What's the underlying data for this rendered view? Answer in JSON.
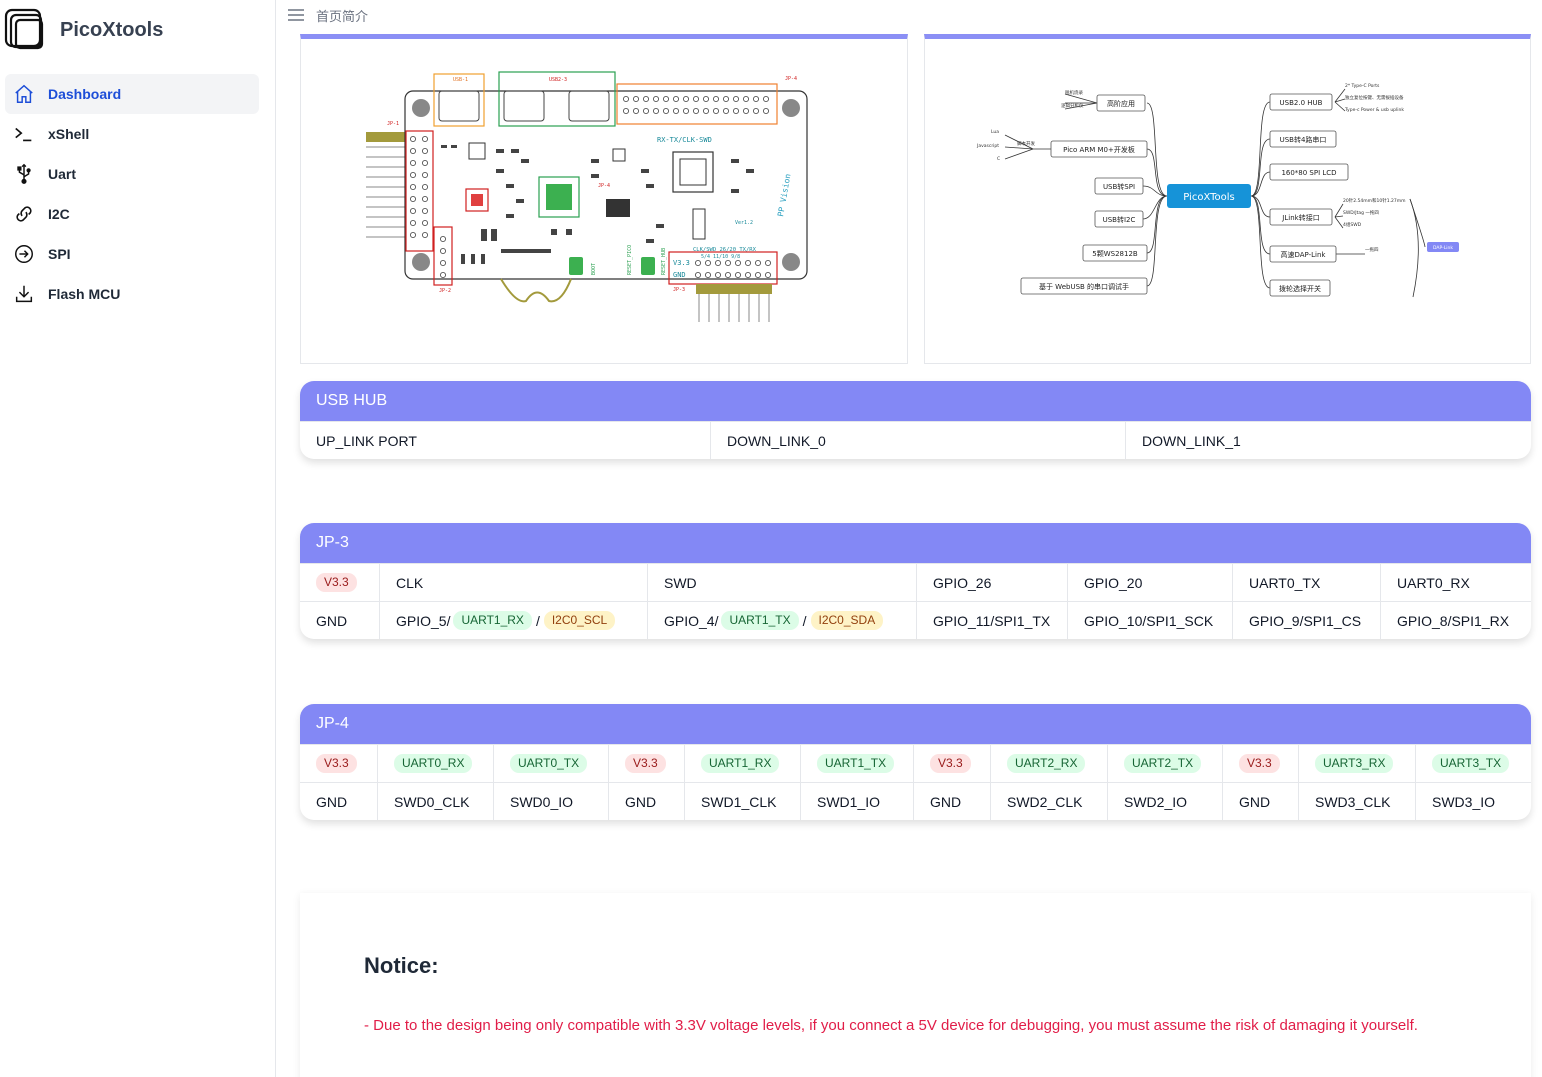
{
  "app": {
    "name": "PicoXtools"
  },
  "sidebar": {
    "items": [
      {
        "label": "Dashboard",
        "icon": "home-icon",
        "active": true
      },
      {
        "label": "xShell",
        "icon": "terminal-icon"
      },
      {
        "label": "Uart",
        "icon": "usb-icon"
      },
      {
        "label": "I2C",
        "icon": "link-icon"
      },
      {
        "label": "SPI",
        "icon": "arrow-circle-icon"
      },
      {
        "label": "Flash MCU",
        "icon": "download-icon"
      }
    ]
  },
  "topbar": {
    "breadcrumb": "首页简介"
  },
  "images": {
    "board": {
      "labels": [
        "USB-1",
        "USB2-3",
        "JP-4",
        "JP-1",
        "JP-2",
        "JP-3",
        "RX-TX/CLK-SWD",
        "CLK/SWD 26/20 TX/RX",
        "5/4 11/10 9/8",
        "V3.3",
        "GND",
        "BOOT",
        "RESET_PICO",
        "RESET_HUB",
        "Ver1.2",
        "PP Vision"
      ]
    },
    "mindmap": {
      "center": "PicoXTools",
      "left": [
        "高阶应用",
        "Pico ARM M0+开发板",
        "USB转SPI",
        "USB转I2C",
        "5颗WS2812B",
        "基于 WebUSB 的串口调试手"
      ],
      "left_sub": [
        "脱机烧录",
        "逻辑分析仪",
        "Lua",
        "Javascript",
        "C",
        "脚本开发"
      ],
      "right": [
        "USB2.0 HUB",
        "USB转4路串口",
        "160*80 SPI LCD",
        "JLink转接口",
        "高速DAP-Link",
        "拨轮选择开关"
      ],
      "right_sub": [
        "2* Type-C Ports",
        "独立复位按键、无需拔插设备",
        "Type-c Power & usb uplink",
        "20针2.54mm和10针1.27mm",
        "SWD/Jtag 一拖四",
        "4组SWD",
        "一拖四",
        "DAP-Link"
      ]
    }
  },
  "usb_hub": {
    "title": "USB HUB",
    "cells": [
      "UP_LINK PORT",
      "DOWN_LINK_0",
      "DOWN_LINK_1"
    ]
  },
  "jp3": {
    "title": "JP-3",
    "row1": [
      "V3.3",
      "CLK",
      "SWD",
      "GPIO_26",
      "GPIO_20",
      "UART0_TX",
      "UART0_RX"
    ],
    "row2": {
      "c0": "GND",
      "c1_pre": "GPIO_5/",
      "c1_b1": "UART1_RX",
      "c1_sep": "/",
      "c1_b2": "I2C0_SCL",
      "c2_pre": "GPIO_4/",
      "c2_b1": "UART1_TX",
      "c2_sep": "/",
      "c2_b2": "I2C0_SDA",
      "c3": "GPIO_11/SPI1_TX",
      "c4": "GPIO_10/SPI1_SCK",
      "c5": "GPIO_9/SPI1_CS",
      "c6": "GPIO_8/SPI1_RX"
    }
  },
  "jp4": {
    "title": "JP-4",
    "row1": [
      "V3.3",
      "UART0_RX",
      "UART0_TX",
      "V3.3",
      "UART1_RX",
      "UART1_TX",
      "V3.3",
      "UART2_RX",
      "UART2_TX",
      "V3.3",
      "UART3_RX",
      "UART3_TX"
    ],
    "row2": [
      "GND",
      "SWD0_CLK",
      "SWD0_IO",
      "GND",
      "SWD1_CLK",
      "SWD1_IO",
      "GND",
      "SWD2_CLK",
      "SWD2_IO",
      "GND",
      "SWD3_CLK",
      "SWD3_IO"
    ]
  },
  "notice": {
    "title": "Notice:",
    "text": "- Due to the design being only compatible with 3.3V voltage levels, if you connect a 5V device for debugging, you must assume the risk of damaging it yourself."
  },
  "colors": {
    "accent": "#8388f5",
    "active": "#1d4ed8",
    "danger": "#e11d48"
  }
}
